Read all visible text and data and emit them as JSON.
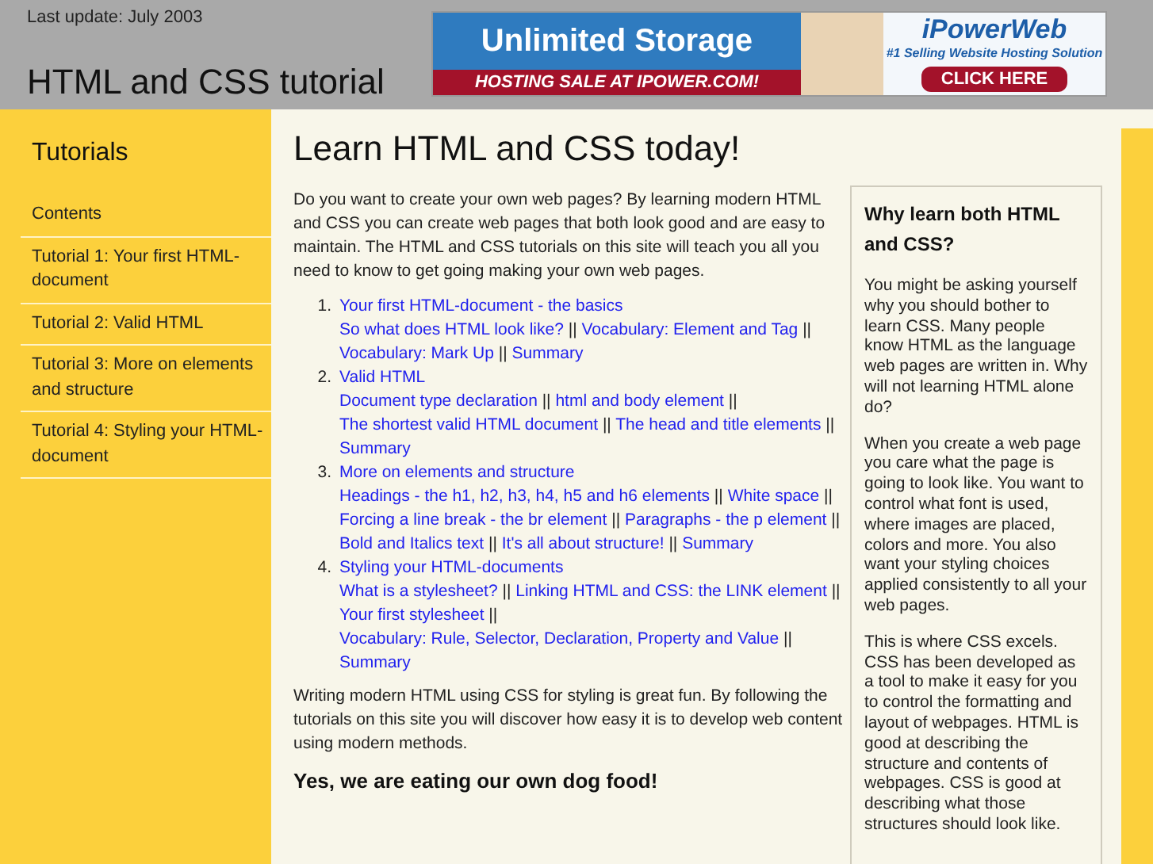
{
  "header": {
    "last_update": "Last update: July 2003",
    "site_title": "HTML and CSS tutorial",
    "banner": {
      "headline": "Unlimited Storage",
      "sale": "HOSTING SALE AT IPOWER.COM!",
      "brand": "iPowerWeb",
      "tagline": "#1 Selling Website Hosting Solution",
      "cta": "CLICK HERE"
    }
  },
  "sidebar": {
    "title": "Tutorials",
    "items": [
      {
        "label": "Contents"
      },
      {
        "label": "Tutorial 1: Your first HTML-document"
      },
      {
        "label": "Tutorial 2: Valid HTML"
      },
      {
        "label": "Tutorial 3: More on elements and structure"
      },
      {
        "label": "Tutorial 4: Styling your HTML-document"
      }
    ]
  },
  "main": {
    "title": "Learn HTML and CSS today!",
    "intro": "Do you want to create your own web pages? By learning modern HTML and CSS you can create web pages that both look good and are easy to maintain. The HTML and CSS tutorials on this site will teach you all you need to know to get going making your own web pages.",
    "separator": "||",
    "tutorials": [
      {
        "number": "1.",
        "title": "Your first HTML-document - the basics",
        "links": [
          "So what does HTML look like?",
          "Vocabulary: Element and Tag",
          "Vocabulary: Mark Up",
          "Summary"
        ]
      },
      {
        "number": "2.",
        "title": "Valid HTML",
        "links": [
          "Document type declaration",
          "html and body element",
          "The shortest valid HTML document",
          "The head and title elements",
          "Summary"
        ]
      },
      {
        "number": "3.",
        "title": "More on elements and structure",
        "links": [
          "Headings - the h1, h2, h3, h4, h5 and h6 elements",
          "White space",
          "Forcing a line break - the br element",
          "Paragraphs - the p element",
          "Bold and Italics text",
          "It's all about structure!",
          "Summary"
        ]
      },
      {
        "number": "4.",
        "title": "Styling your HTML-documents",
        "links": [
          "What is a stylesheet?",
          "Linking HTML and CSS: the LINK element",
          "Your first stylesheet",
          "Vocabulary: Rule, Selector, Declaration, Property and Value",
          "Summary"
        ]
      }
    ],
    "outro": "Writing modern HTML using CSS for styling is great fun. By following the tutorials on this site you will discover how easy it is to develop web content using modern methods.",
    "subheading": "Yes, we are eating our own dog food!"
  },
  "aside": {
    "title": "Why learn both HTML and CSS?",
    "paragraphs": [
      "You might be asking yourself why you should bother to learn CSS. Many people know HTML as the language web pages are written in. Why will not learning HTML alone do?",
      "When you create a web page you care what the page is going to look like. You want to control what font is used, where images are placed, colors and more. You also want your styling choices applied consistently to all your web pages.",
      "This is where CSS excels. CSS has been developed as a tool to make it easy for you to control the formatting and layout of webpages. HTML is good at describing the structure and contents of webpages. CSS is good at describing what those structures should look like."
    ]
  }
}
